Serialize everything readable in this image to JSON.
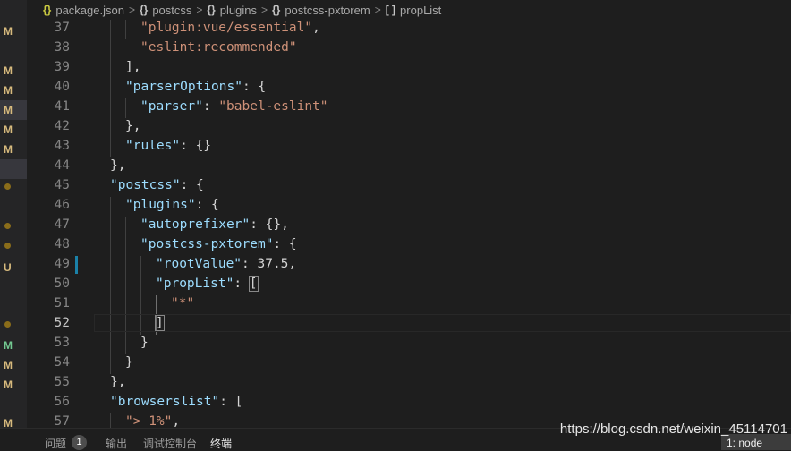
{
  "breadcrumb": {
    "items": [
      {
        "icon": "{}",
        "label": "package.json"
      },
      {
        "icon": "{}",
        "label": "postcss"
      },
      {
        "icon": "{}",
        "label": "plugins"
      },
      {
        "icon": "{}",
        "label": "postcss-pxtorem"
      },
      {
        "icon": "[ ]",
        "label": "propList"
      }
    ],
    "separator": ">"
  },
  "git_markers": [
    "M",
    "M",
    "M",
    "M",
    "M",
    "M",
    "U",
    "M",
    "M",
    "M"
  ],
  "lines": {
    "n37": "37",
    "n38": "38",
    "n39": "39",
    "n40": "40",
    "n41": "41",
    "n42": "42",
    "n43": "43",
    "n44": "44",
    "n45": "45",
    "n46": "46",
    "n47": "47",
    "n48": "48",
    "n49": "49",
    "n50": "50",
    "n51": "51",
    "n52": "52",
    "n53": "53",
    "n54": "54",
    "n55": "55",
    "n56": "56",
    "n57": "57",
    "l37_s": "\"plugin:vue/essential\"",
    "l37_p": ",",
    "l38_s": "\"eslint:recommended\"",
    "l39_p": "],",
    "l40_k": "\"parserOptions\"",
    "l40_p": ": {",
    "l41_k": "\"parser\"",
    "l41_p": ": ",
    "l41_s": "\"babel-eslint\"",
    "l42_p": "},",
    "l43_k": "\"rules\"",
    "l43_p": ": {}",
    "l44_p": "},",
    "l45_k": "\"postcss\"",
    "l45_p": ": {",
    "l46_k": "\"plugins\"",
    "l46_p": ": {",
    "l47_k": "\"autoprefixer\"",
    "l47_p": ": {},",
    "l48_k": "\"postcss-pxtorem\"",
    "l48_p": ": {",
    "l49_k": "\"rootValue\"",
    "l49_p": ": 37.5,",
    "l50_k": "\"propList\"",
    "l50_p": ": ",
    "l50_b": "[",
    "l51_s": "\"*\"",
    "l52_b": "]",
    "l53_p": "}",
    "l54_p": "}",
    "l55_p": "},",
    "l56_k": "\"browserslist\"",
    "l56_p": ": [",
    "l57_s": "\"> 1%\"",
    "l57_p": ","
  },
  "colors": {
    "modified": "#d7ba7d",
    "untracked": "#73c991",
    "dot": "#8a6d1a",
    "key": "#9cdcfe",
    "string": "#ce9178"
  },
  "watermark": "https://blog.csdn.net/weixin_45114701",
  "panel": {
    "tabs": [
      "问题",
      "输出",
      "调试控制台",
      "终端"
    ],
    "problems_count": "1",
    "terminal_selector": "1: node"
  }
}
